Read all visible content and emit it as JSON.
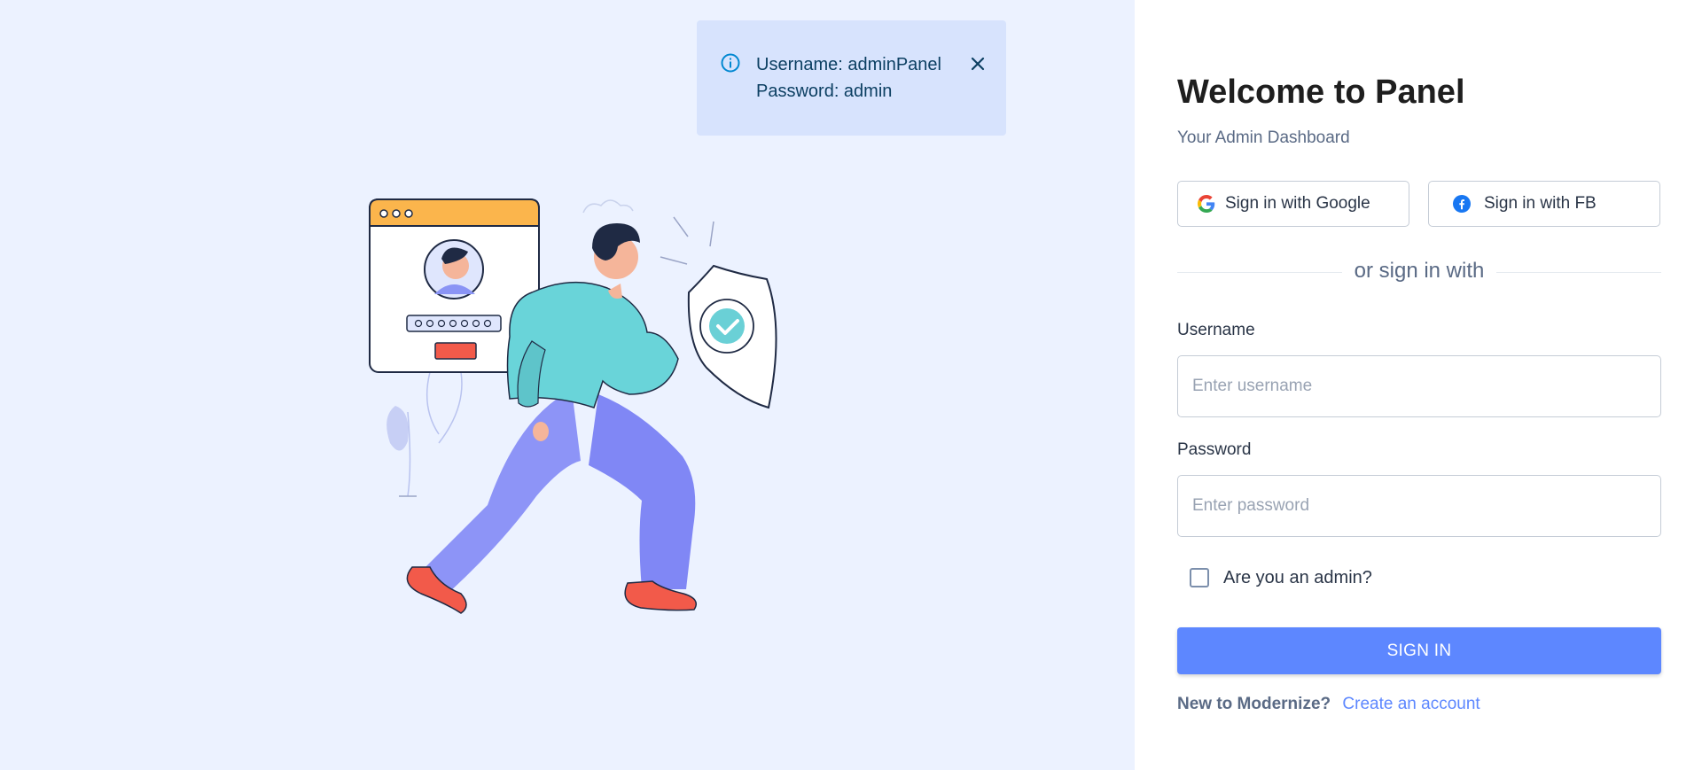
{
  "alert": {
    "icon": "info-icon",
    "line1": "Username: adminPanel",
    "line2": "Password: admin",
    "close_icon": "close-icon"
  },
  "illustration": {
    "name": "person-with-shield-login-illustration"
  },
  "login": {
    "title": "Welcome to Panel",
    "subtitle": "Your Admin Dashboard",
    "google_label": "Sign in with Google",
    "facebook_label": "Sign in with FB",
    "divider_text": "or sign in with",
    "username_label": "Username",
    "username_placeholder": "Enter username",
    "username_value": "",
    "password_label": "Password",
    "password_placeholder": "Enter password",
    "password_value": "",
    "admin_checkbox_label": "Are you an admin?",
    "admin_checked": false,
    "signin_label": "SIGN IN",
    "footer_question": "New to Modernize?",
    "footer_link": "Create an account"
  },
  "colors": {
    "left_bg": "#ecf2ff",
    "primary": "#5d87ff",
    "alert_bg": "#d7e3fd"
  }
}
